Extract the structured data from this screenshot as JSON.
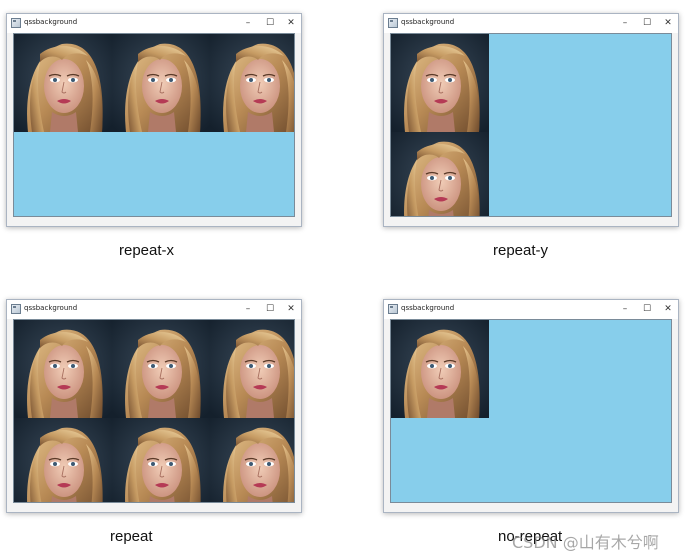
{
  "windows": [
    {
      "id": "repeat-x",
      "title": "qssbackground",
      "caption": "repeat-x",
      "repeat": "repeat-x"
    },
    {
      "id": "repeat-y",
      "title": "qssbackground",
      "caption": "repeat-y",
      "repeat": "repeat-y"
    },
    {
      "id": "repeat",
      "title": "qssbackground",
      "caption": "repeat",
      "repeat": "repeat"
    },
    {
      "id": "no-repeat",
      "title": "qssbackground",
      "caption": "no-repeat",
      "repeat": "no-repeat"
    }
  ],
  "window_controls": {
    "minimize": "–",
    "maximize": "☐",
    "close": "✕"
  },
  "client_background": "#87ceeb",
  "watermark": "CSDN @山有木兮啊"
}
